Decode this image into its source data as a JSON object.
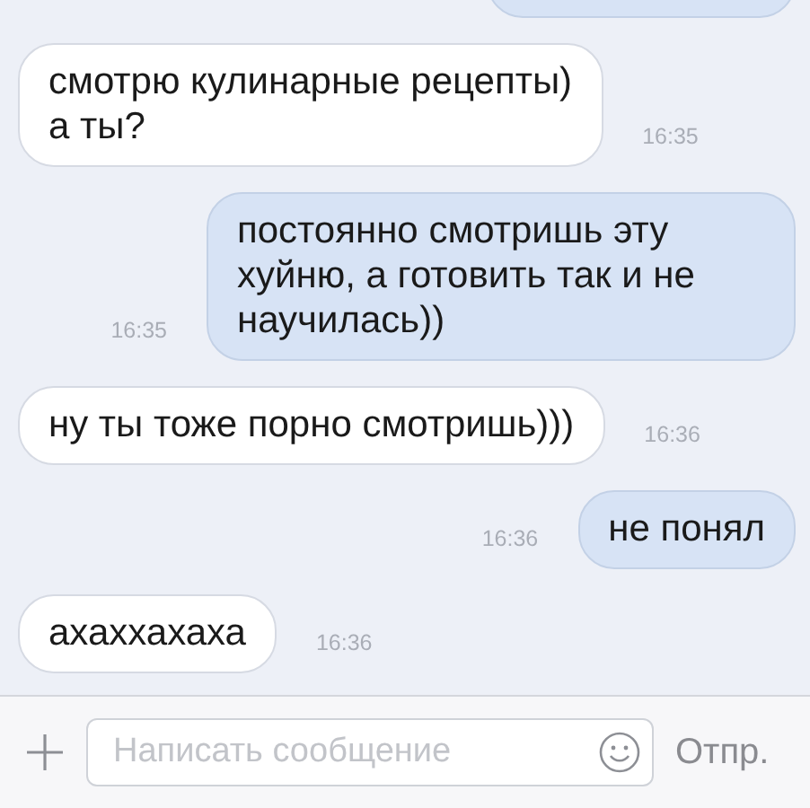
{
  "messages": [
    {
      "kind": "out",
      "cut": true
    },
    {
      "kind": "in",
      "text": "смотрю кулинарные рецепты)\nа ты?",
      "time": "16:35"
    },
    {
      "kind": "out",
      "text": "постоянно смотришь эту хуйню, а готовить так и не научилась))",
      "time": "16:35"
    },
    {
      "kind": "in",
      "text": "ну ты тоже порно смотришь)))",
      "time": "16:36"
    },
    {
      "kind": "out",
      "text": "не понял",
      "time": "16:36"
    },
    {
      "kind": "in",
      "text": "ахаххахаха",
      "time": "16:36"
    }
  ],
  "composer": {
    "placeholder": "Написать сообщение",
    "send": "Отпр."
  }
}
